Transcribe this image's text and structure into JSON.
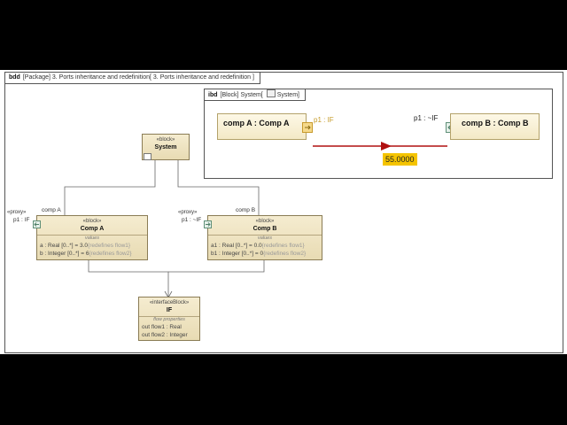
{
  "bdd": {
    "kind": "bdd",
    "header": "[Package] 3. Ports inheritance and redefinition[ 3. Ports inheritance and redefinition ]"
  },
  "ibd": {
    "kind": "ibd",
    "header_pre": "[Block] System[",
    "header_post": "System]",
    "part_a": "comp A : Comp A",
    "port_a": "p1 : IF",
    "part_b": "comp B : Comp B",
    "port_b": "p1 : ~IF",
    "value": "55.0000"
  },
  "system_block": {
    "stereotype": "«block»",
    "name": "System"
  },
  "comp_a": {
    "stereotype": "«block»",
    "name": "Comp A",
    "section": "values",
    "rows": [
      {
        "text": "a : Real [0..*] = 3.0",
        "note": "{redefines flow1}"
      },
      {
        "text": "b : Integer [0..*] = 6",
        "note": "{redefines flow2}"
      }
    ],
    "role": "comp A",
    "port_stereo": "«proxy»",
    "port_name": "p1 : IF"
  },
  "comp_b": {
    "stereotype": "«block»",
    "name": "Comp B",
    "section": "values",
    "rows": [
      {
        "text": "a1 : Real [0..*] = 0.0",
        "note": "{redefines flow1}"
      },
      {
        "text": "b1 : Integer [0..*] = 0",
        "note": "{redefines flow2}"
      }
    ],
    "role": "comp B",
    "port_stereo": "«proxy»",
    "port_name": "p1 : ~IF"
  },
  "interface_block": {
    "stereotype": "«interfaceBlock»",
    "name": "IF",
    "section": "flow properties",
    "rows": [
      "out flow1 : Real",
      "out flow2 : Integer"
    ]
  },
  "colors": {
    "connector": "#b01010",
    "port_border": "#5f8f78",
    "value_bg": "#f5c400"
  }
}
